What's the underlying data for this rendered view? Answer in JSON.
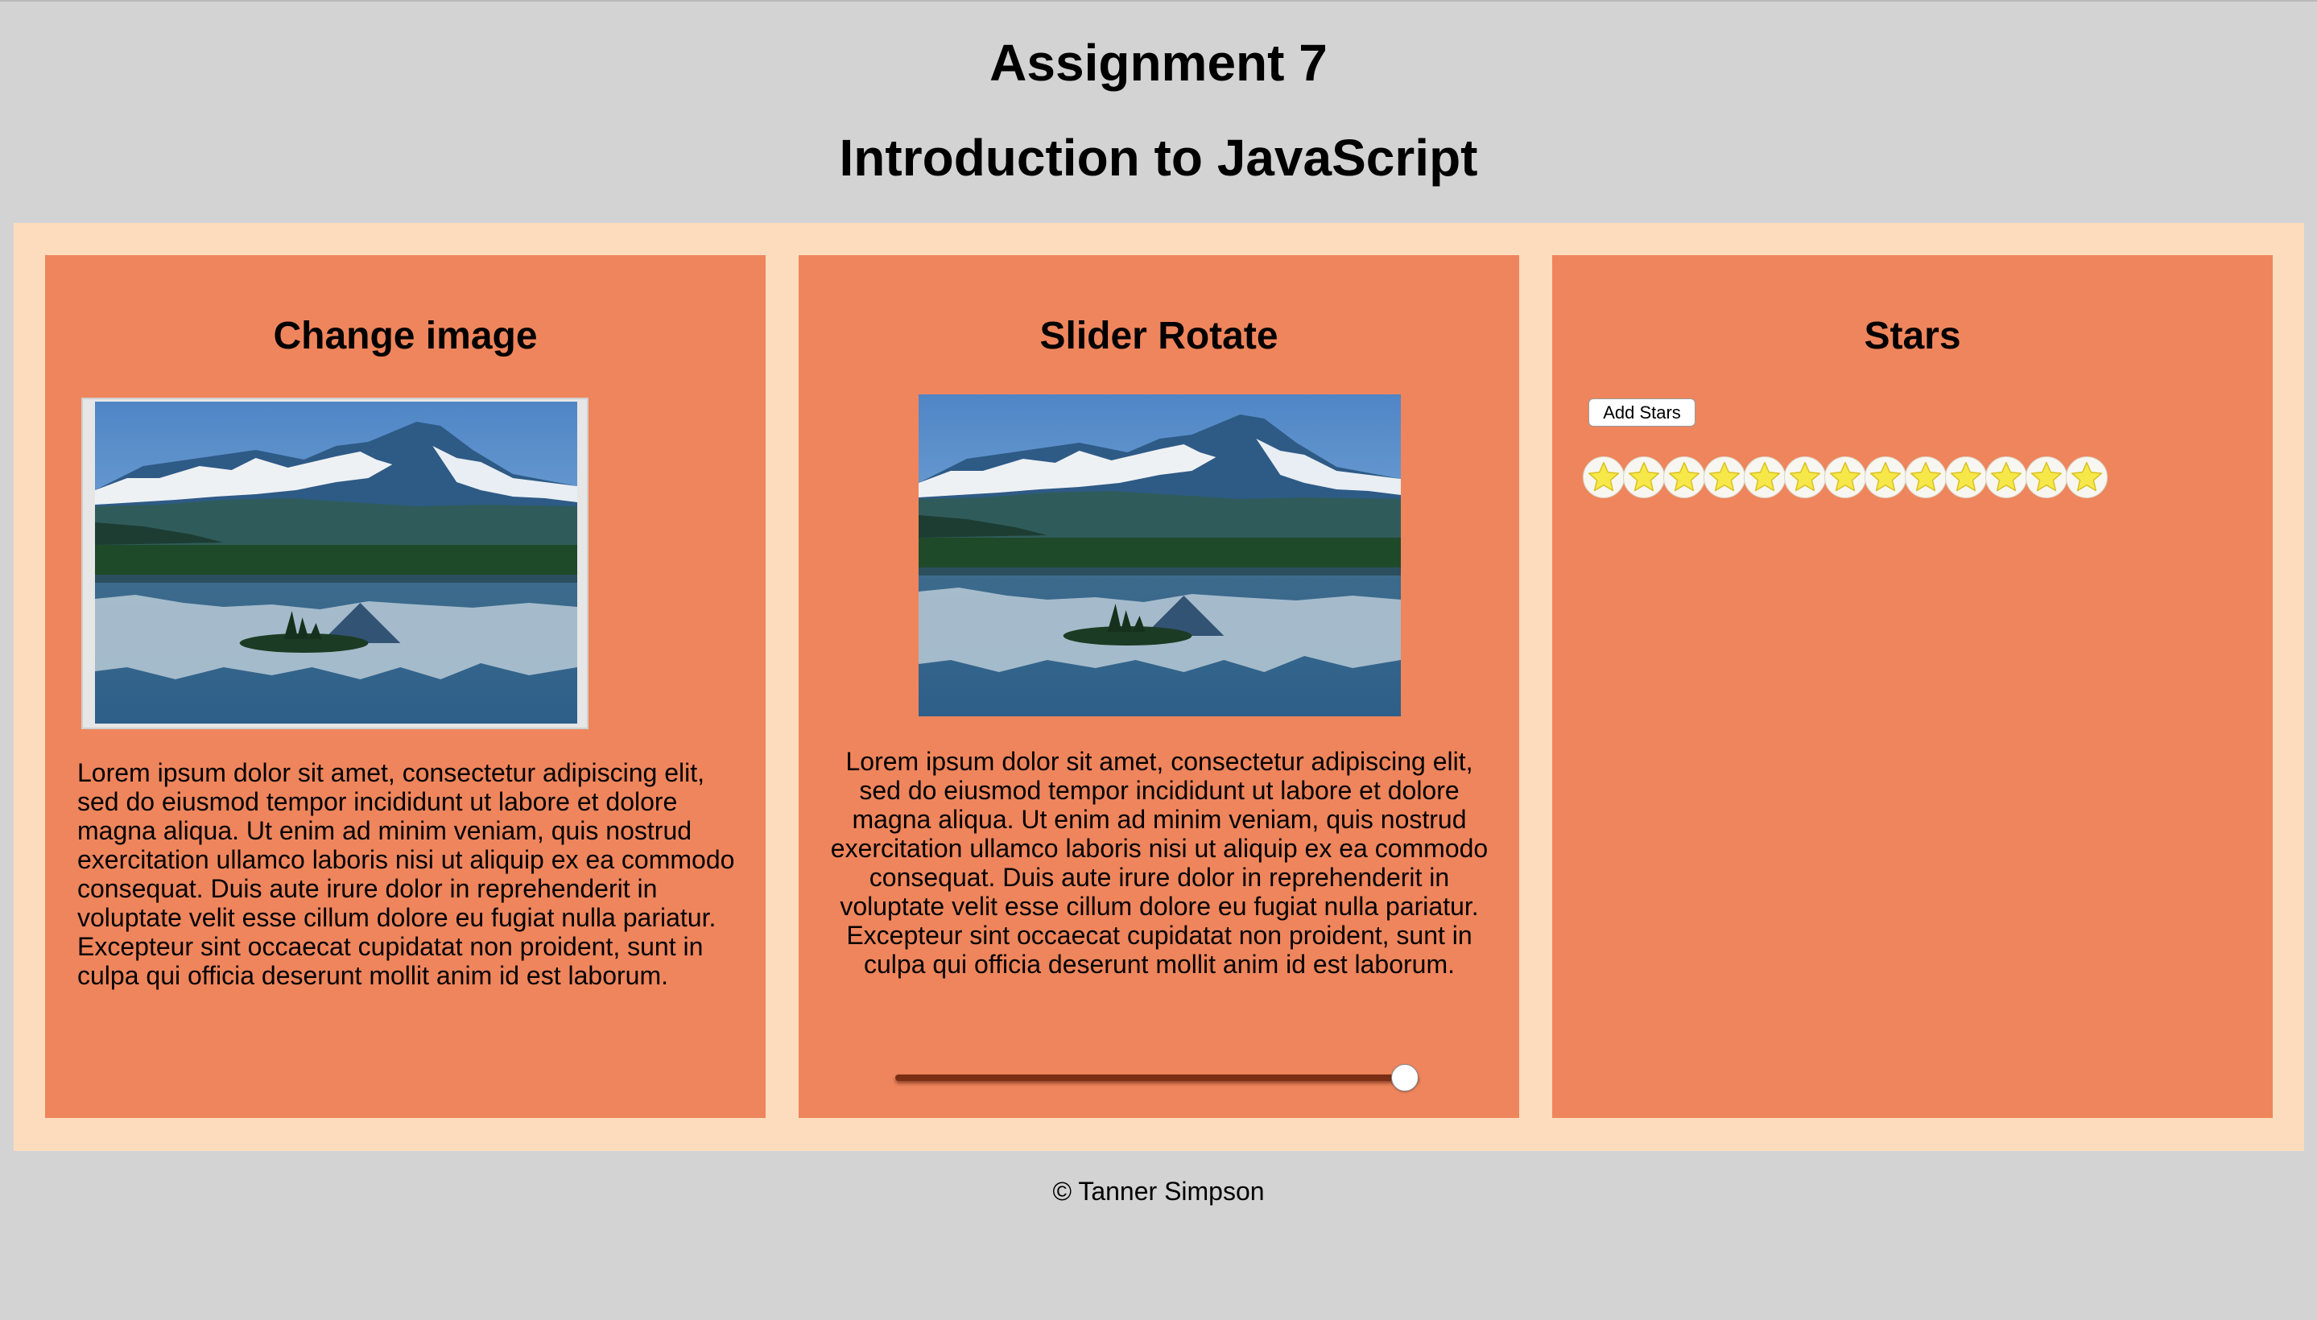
{
  "header": {
    "title": "Assignment 7",
    "subtitle": "Introduction to JavaScript"
  },
  "cards": {
    "change_image": {
      "heading": "Change image",
      "image": "mountain-lake-photo",
      "text": "Lorem ipsum dolor sit amet, consectetur adipiscing elit, sed do eiusmod tempor incididunt ut labore et dolore magna aliqua. Ut enim ad minim veniam, quis nostrud exercitation ullamco laboris nisi ut aliquip ex ea commodo consequat. Duis aute irure dolor in reprehenderit in voluptate velit esse cillum dolore eu fugiat nulla pariatur. Excepteur sint occaecat cupidatat non proident, sunt in culpa qui officia deserunt mollit anim id est laborum."
    },
    "slider_rotate": {
      "heading": "Slider Rotate",
      "image": "mountain-lake-photo",
      "text": "Lorem ipsum dolor sit amet, consectetur adipiscing elit, sed do eiusmod tempor incididunt ut labore et dolore magna aliqua. Ut enim ad minim veniam, quis nostrud exercitation ullamco laboris nisi ut aliquip ex ea commodo consequat. Duis aute irure dolor in reprehenderit in voluptate velit esse cillum dolore eu fugiat nulla pariatur. Excepteur sint occaecat cupidatat non proident, sunt in culpa qui officia deserunt mollit anim id est laborum.",
      "slider_value_fraction": 1.0
    },
    "stars": {
      "heading": "Stars",
      "button_label": "Add Stars",
      "star_count": 13,
      "star_icon": "star-icon"
    }
  },
  "footer": {
    "text": "© Tanner Simpson"
  },
  "colors": {
    "page_background": "#d3d3d3",
    "container_background": "#fcdcbd",
    "card_background": "#ef855c",
    "star_fill": "#f7e84a"
  }
}
